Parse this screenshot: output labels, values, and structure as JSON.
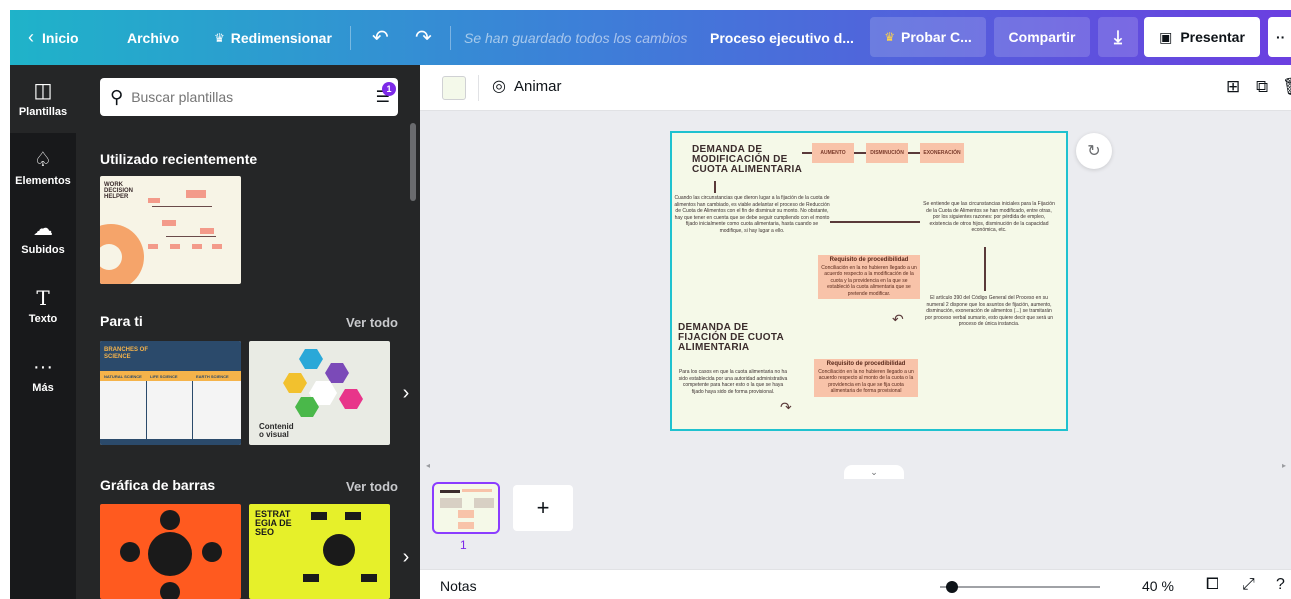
{
  "topbar": {
    "home_label": "Inicio",
    "file_label": "Archivo",
    "resize_label": "Redimensionar",
    "saved_status": "Se han guardado todos los cambios",
    "doc_title": "Proceso ejecutivo d...",
    "try_label": "Probar C...",
    "share_label": "Compartir",
    "present_label": "Presentar",
    "more_label": "··"
  },
  "rail": {
    "items": [
      {
        "label": "Plantillas",
        "icon": "layout-icon"
      },
      {
        "label": "Elementos",
        "icon": "shapes-icon"
      },
      {
        "label": "Subidos",
        "icon": "cloud-upload-icon"
      },
      {
        "label": "Texto",
        "icon": "text-icon"
      },
      {
        "label": "Más",
        "icon": "more-icon"
      }
    ]
  },
  "panel": {
    "search_placeholder": "Buscar plantillas",
    "filter_badge": "1",
    "recent_title": "Utilizado recientemente",
    "for_you_title": "Para ti",
    "bar_chart_title": "Gráfica de barras",
    "see_all_label": "Ver todo",
    "thumbs": {
      "recent_1_title": "WORK DECISION HELPER",
      "for_you_1_title": "BRANCHES OF SCIENCE",
      "for_you_1_cols": [
        "NATURAL SCIENCE",
        "LIFE SCIENCE",
        "EARTH SCIENCE"
      ],
      "for_you_2_title": "Contenid o visual",
      "bar_2_title": "ESTRAT EGIA DE SEO"
    }
  },
  "editor": {
    "animate_label": "Animar",
    "swatch_color": "#f4f9ea"
  },
  "canvas": {
    "title_1": "DEMANDA DE MODIFICACIÓN DE CUOTA ALIMENTARIA",
    "box_aumento": "AUMENTO",
    "box_disminucion": "DISMINUCIÓN",
    "box_exoneracion": "EXONERACIÓN",
    "text_left": "Cuando las circunstancias que dieron lugar a la fijación de la cuota de alimentos han cambiado, es viable adelantar el proceso de Reducción de Cuota de Alimentos con el fin de disminuir su monto. No obstante, hay que tener en cuenta que se debe seguir cumpliendo con el monto fijado inicialmente como cuota alimentaria, hasta cuando se modifique, si hay lugar a ello.",
    "text_right": "Se entiende que las circunstancias iniciales para la Fijación de la Cuota de Alimentos se han modificado, entre otras, por los siguientes razones: por pérdida de empleo, existencia de otros hijos, disminución de la capacidad económica, etc.",
    "req_title": "Requisito de procedibilidad",
    "req_1_text": "Conciliación en la no hubieren llegado a un acuerdo respecto a la modificación de la cuota y la providencia en la que se estableció la cuota alimentaria que se pretende modificar.",
    "text_article": "El artículo 390 del Código General del Proceso en su numeral 2 dispone que los asuntos de fijación, aumento, disminución, exoneración de alimentos (...) se tramitarán por proceso verbal sumario, esto quiere decir que será un proceso de única instancia.",
    "title_2": "DEMANDA DE FIJACIÓN DE CUOTA ALIMENTARIA",
    "text_bottom": "Para los casos en que la cuota alimentaria no ha sido establecida por una autoridad administrativa competente para hacer esto o la que se haya fijado haya sido de forma provisional.",
    "req_2_text": "Conciliación en la no hubieren llegado a un acuerdo respecto al monto de la cuota o la providencia en la que se fija cuota alimentaria de forma provisional"
  },
  "pages": {
    "current_page": "1"
  },
  "footer": {
    "notes_label": "Notas",
    "zoom_level": "40 %"
  }
}
